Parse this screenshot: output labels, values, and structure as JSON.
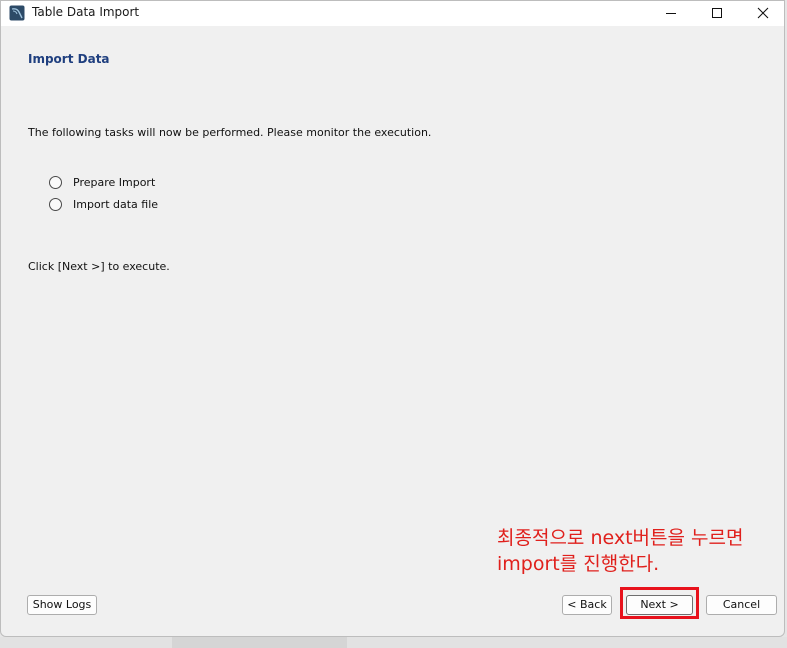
{
  "window": {
    "title": "Table Data Import",
    "controls": [
      "minimize-icon",
      "maximize-icon",
      "close-icon"
    ]
  },
  "page": {
    "heading": "Import Data",
    "intro": "The following tasks will now be performed. Please monitor the execution.",
    "tasks": [
      {
        "label": "Prepare Import",
        "checked": false
      },
      {
        "label": "Import data file",
        "checked": false
      }
    ],
    "hint": "Click [Next >] to execute."
  },
  "annotation": {
    "line1": "최종적으로 next버튼을 누르면",
    "line2": "import를 진행한다.",
    "color": "#e0201c"
  },
  "buttons": {
    "show_logs": "Show Logs",
    "back": "< Back",
    "next": "Next >",
    "cancel": "Cancel"
  },
  "colors": {
    "heading": "#1f3f7f",
    "highlight_box": "#e8121c",
    "window_bg": "#f0f0f0"
  }
}
